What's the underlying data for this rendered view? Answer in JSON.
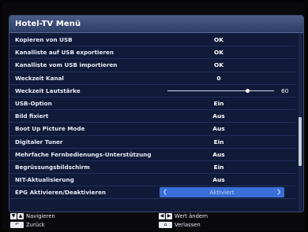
{
  "menu": {
    "title": "Hotel-TV Menü",
    "items": [
      {
        "label": "Kopieren von USB",
        "value": "OK"
      },
      {
        "label": "Kanalliste auf USB exportieren",
        "value": "OK"
      },
      {
        "label": "Kanalliste vom USB importieren",
        "value": "OK"
      },
      {
        "label": "Weckzeit Kanal",
        "value": "0"
      },
      {
        "label": "Weckzeit Lautstärke",
        "value": "60",
        "slider_fraction": 0.75
      },
      {
        "label": "USB-Option",
        "value": "Ein"
      },
      {
        "label": "Bild fixiert",
        "value": "Aus"
      },
      {
        "label": "Boot Up Picture Mode",
        "value": "Aus"
      },
      {
        "label": "Digitaler Tuner",
        "value": "Ein"
      },
      {
        "label": "Mehrfache Fernbedienungs-Unterstützung",
        "value": "Aus"
      },
      {
        "label": "Begrüssungsbildschirm",
        "value": "Ein"
      },
      {
        "label": "NIT-Aktualisierung",
        "value": "Aus"
      },
      {
        "label": "EPG Aktivieren/Deaktivieren",
        "value": "Aktiviert",
        "selected": true
      }
    ]
  },
  "footer": {
    "navigate": "Navigieren",
    "back": "Zurück",
    "change_value": "Wert ändern",
    "exit": "Verlassen"
  },
  "colors": {
    "menu_background": "#101a39",
    "title_bar": "#3a4d78",
    "selection": "#3a6ed8"
  },
  "icons": {
    "navigate": "up-down-arrows-icon",
    "back": "back-arrow-icon",
    "change_value": "left-right-arrows-icon",
    "exit": "home-icon"
  }
}
